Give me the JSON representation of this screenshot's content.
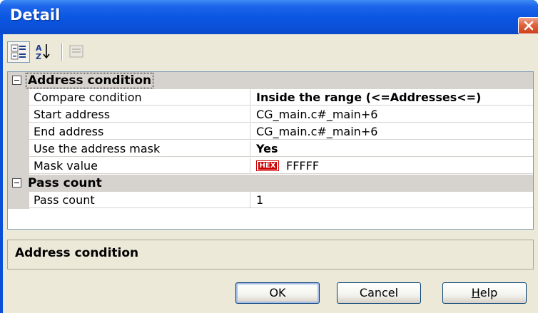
{
  "window": {
    "title": "Detail"
  },
  "toolbar": {
    "categorized_icon": "categorized-view-icon",
    "alphabetical_icon": "alphabetical-sort-icon",
    "property_pages_icon": "property-pages-icon"
  },
  "grid": {
    "categories": [
      {
        "label": "Address condition",
        "properties": [
          {
            "name": "Compare condition",
            "value": "Inside the range (<=Addresses<=)"
          },
          {
            "name": "Start address",
            "value": "CG_main.c#_main+6"
          },
          {
            "name": "End address",
            "value": "CG_main.c#_main+6"
          },
          {
            "name": "Use the address mask",
            "value": "Yes"
          },
          {
            "name": "Mask value",
            "value": "FFFFF",
            "badge": "HEX"
          }
        ]
      },
      {
        "label": "Pass count",
        "properties": [
          {
            "name": "Pass count",
            "value": "1"
          }
        ]
      }
    ]
  },
  "description": {
    "title": "Address condition"
  },
  "buttons": {
    "ok": "OK",
    "cancel": "Cancel",
    "help_underlined": "H",
    "help_rest": "elp"
  },
  "colors": {
    "titlebar": "#0a55e0",
    "client": "#ece9d8",
    "category_row": "#d6d3ce",
    "close_button": "#e0643f"
  }
}
